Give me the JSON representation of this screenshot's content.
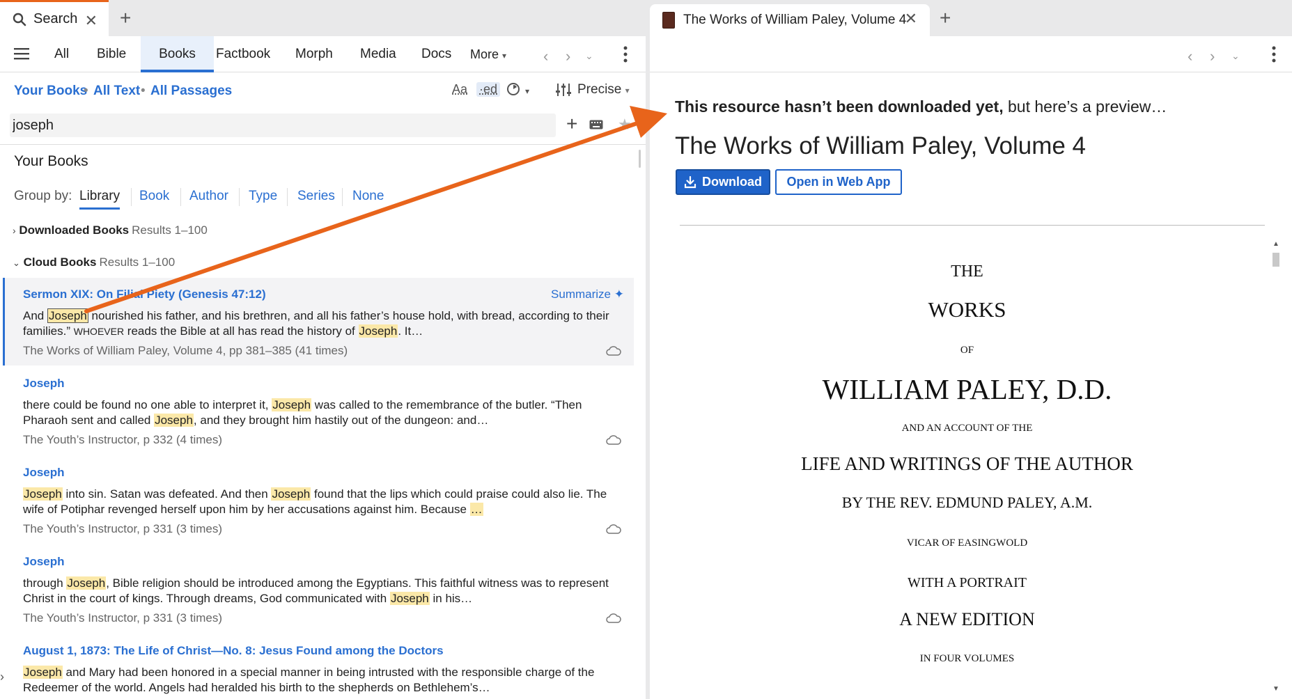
{
  "left": {
    "tab": {
      "label": "Search"
    },
    "nav": {
      "items": [
        "All",
        "Bible",
        "Books",
        "Factbook",
        "Morph",
        "Media",
        "Docs"
      ],
      "more": "More"
    },
    "filters": {
      "your_books": "Your Books",
      "all_text": "All Text",
      "all_passages": "All Passages",
      "precise": "Precise",
      "aa": "Aa",
      "ed": "·ed"
    },
    "search": {
      "value": "joseph"
    },
    "section_title": "Your Books",
    "group_by": {
      "label": "Group by:",
      "options": [
        "Library",
        "Book",
        "Author",
        "Type",
        "Series",
        "None"
      ]
    },
    "downloaded": {
      "label": "Downloaded Books",
      "range": "Results 1–100"
    },
    "cloud": {
      "label": "Cloud Books",
      "range": "Results 1–100"
    },
    "results": [
      {
        "title": "Sermon XIX: On Filial Piety (Genesis 47:12)",
        "summarize": "Summarize",
        "t1": "And ",
        "h1": "Joseph",
        "t2": " nourished his father, and his brethren, and all his father’s house hold, with bread, according to their families.” ",
        "sc": "Whoever",
        "t3": " reads the Bible at all has read the history of ",
        "h2": "Joseph",
        "t4": ". It…",
        "meta": "The Works of William Paley, Volume 4, pp 381–385 (41 times)"
      },
      {
        "title": "Joseph",
        "t1": "there could be found no one able to interpret it, ",
        "h1": "Joseph",
        "t2": " was called to the remembrance of the butler. “Then Pharaoh sent and called ",
        "h2": "Joseph",
        "t3": ", and they brought him hastily out of the dungeon: and…",
        "meta": "The Youth’s Instructor, p 332 (4 times)"
      },
      {
        "title": "Joseph",
        "h1": "Joseph",
        "t1": " into sin. Satan was defeated. And then ",
        "h2": "Joseph",
        "t2": " found that the lips which could praise could also lie. The wife of Potiphar revenged herself upon him by her accusations against him. Because ",
        "h3": "…",
        "meta": "The Youth’s Instructor, p 331 (3 times)"
      },
      {
        "title": "Joseph",
        "t1": "through ",
        "h1": "Joseph",
        "t2": ", Bible religion should be introduced among the Egyptians. This faithful witness was to represent Christ in the court of kings. Through dreams, God communicated with ",
        "h2": "Joseph",
        "t3": " in his…",
        "meta": "The Youth’s Instructor, p 331 (3 times)"
      },
      {
        "title": "August 1, 1873: The Life of Christ—No. 8: Jesus Found among the Doctors",
        "h1": "Joseph",
        "t1": " and Mary had been honored in a special manner in being intrusted with the responsible charge of the Redeemer of the world. Angels had heralded his birth to the shepherds on Bethlehem’s…"
      }
    ]
  },
  "right": {
    "tab": {
      "label": "The Works of William Paley, Volume 4"
    },
    "notice_bold": "This resource hasn’t been downloaded yet,",
    "notice_rest": " but here’s a preview…",
    "title": "The Works of William Paley, Volume 4",
    "download": "Download",
    "open_web": "Open in Web App",
    "page_lines": [
      "THE",
      "WORKS",
      "OF",
      "WILLIAM PALEY, D.D.",
      "AND AN ACCOUNT OF THE",
      "LIFE AND WRITINGS OF THE AUTHOR",
      "BY THE REV. EDMUND PALEY, A.M.",
      "VICAR OF EASINGWOLD",
      "WITH A PORTRAIT",
      "A NEW EDITION",
      "IN FOUR VOLUMES"
    ]
  },
  "colors": {
    "accent": "#2a6fd1",
    "arrow": "#e8641b",
    "highlight": "#fbe8a8",
    "button": "#1f63c9"
  }
}
